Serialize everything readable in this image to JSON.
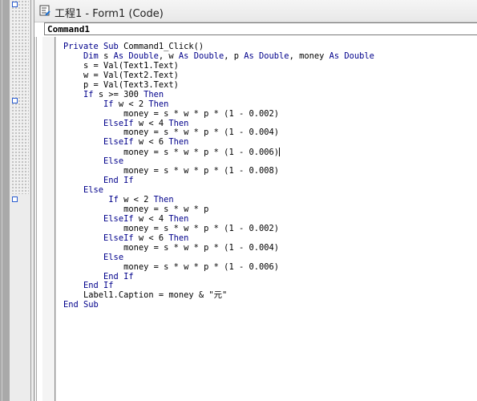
{
  "window": {
    "title": "工程1 - Form1 (Code)"
  },
  "object_combo": {
    "value": "Command1"
  },
  "colors": {
    "keyword": "#00008b",
    "text": "#000000"
  },
  "code_lines": [
    {
      "tokens": [
        {
          "t": "Private Sub ",
          "k": 1
        },
        {
          "t": "Command1_Click()",
          "k": 0
        }
      ]
    },
    {
      "tokens": [
        {
          "t": "    ",
          "k": 0
        },
        {
          "t": "Dim ",
          "k": 1
        },
        {
          "t": "s ",
          "k": 0
        },
        {
          "t": "As Double",
          "k": 1
        },
        {
          "t": ", w ",
          "k": 0
        },
        {
          "t": "As Double",
          "k": 1
        },
        {
          "t": ", p ",
          "k": 0
        },
        {
          "t": "As Double",
          "k": 1
        },
        {
          "t": ", money ",
          "k": 0
        },
        {
          "t": "As Double",
          "k": 1
        }
      ]
    },
    {
      "tokens": [
        {
          "t": "    s = Val(Text1.Text)",
          "k": 0
        }
      ]
    },
    {
      "tokens": [
        {
          "t": "    w = Val(Text2.Text)",
          "k": 0
        }
      ]
    },
    {
      "tokens": [
        {
          "t": "    p = Val(Text3.Text)",
          "k": 0
        }
      ]
    },
    {
      "tokens": [
        {
          "t": "    ",
          "k": 0
        },
        {
          "t": "If ",
          "k": 1
        },
        {
          "t": "s >= 300 ",
          "k": 0
        },
        {
          "t": "Then",
          "k": 1
        }
      ]
    },
    {
      "tokens": [
        {
          "t": "        ",
          "k": 0
        },
        {
          "t": "If ",
          "k": 1
        },
        {
          "t": "w < 2 ",
          "k": 0
        },
        {
          "t": "Then",
          "k": 1
        }
      ]
    },
    {
      "tokens": [
        {
          "t": "            money = s * w * p * (1 - 0.002)",
          "k": 0
        }
      ]
    },
    {
      "tokens": [
        {
          "t": "        ",
          "k": 0
        },
        {
          "t": "ElseIf ",
          "k": 1
        },
        {
          "t": "w < 4 ",
          "k": 0
        },
        {
          "t": "Then",
          "k": 1
        }
      ]
    },
    {
      "tokens": [
        {
          "t": "            money = s * w * p * (1 - 0.004)",
          "k": 0
        }
      ]
    },
    {
      "tokens": [
        {
          "t": "        ",
          "k": 0
        },
        {
          "t": "ElseIf ",
          "k": 1
        },
        {
          "t": "w < 6 ",
          "k": 0
        },
        {
          "t": "Then",
          "k": 1
        }
      ]
    },
    {
      "tokens": [
        {
          "t": "            money = s * w * p * (1 - 0.006)",
          "k": 0
        }
      ],
      "caret": true
    },
    {
      "tokens": [
        {
          "t": "        ",
          "k": 0
        },
        {
          "t": "Else",
          "k": 1
        }
      ]
    },
    {
      "tokens": [
        {
          "t": "            money = s * w * p * (1 - 0.008)",
          "k": 0
        }
      ]
    },
    {
      "tokens": [
        {
          "t": "        ",
          "k": 0
        },
        {
          "t": "End If",
          "k": 1
        }
      ]
    },
    {
      "tokens": [
        {
          "t": "    ",
          "k": 0
        },
        {
          "t": "Else",
          "k": 1
        }
      ]
    },
    {
      "tokens": [
        {
          "t": "         ",
          "k": 0
        },
        {
          "t": "If ",
          "k": 1
        },
        {
          "t": "w < 2 ",
          "k": 0
        },
        {
          "t": "Then",
          "k": 1
        }
      ]
    },
    {
      "tokens": [
        {
          "t": "            money = s * w * p",
          "k": 0
        }
      ]
    },
    {
      "tokens": [
        {
          "t": "        ",
          "k": 0
        },
        {
          "t": "ElseIf ",
          "k": 1
        },
        {
          "t": "w < 4 ",
          "k": 0
        },
        {
          "t": "Then",
          "k": 1
        }
      ]
    },
    {
      "tokens": [
        {
          "t": "            money = s * w * p * (1 - 0.002)",
          "k": 0
        }
      ]
    },
    {
      "tokens": [
        {
          "t": "        ",
          "k": 0
        },
        {
          "t": "ElseIf ",
          "k": 1
        },
        {
          "t": "w < 6 ",
          "k": 0
        },
        {
          "t": "Then",
          "k": 1
        }
      ]
    },
    {
      "tokens": [
        {
          "t": "            money = s * w * p * (1 - 0.004)",
          "k": 0
        }
      ]
    },
    {
      "tokens": [
        {
          "t": "        ",
          "k": 0
        },
        {
          "t": "Else",
          "k": 1
        }
      ]
    },
    {
      "tokens": [
        {
          "t": "            money = s * w * p * (1 - 0.006)",
          "k": 0
        }
      ]
    },
    {
      "tokens": [
        {
          "t": "        ",
          "k": 0
        },
        {
          "t": "End If",
          "k": 1
        }
      ]
    },
    {
      "tokens": [
        {
          "t": "    ",
          "k": 0
        },
        {
          "t": "End If",
          "k": 1
        }
      ]
    },
    {
      "tokens": [
        {
          "t": "    Label1.Caption = money & \"元\"",
          "k": 0
        }
      ]
    },
    {
      "tokens": [
        {
          "t": "End Sub",
          "k": 1
        }
      ]
    }
  ]
}
